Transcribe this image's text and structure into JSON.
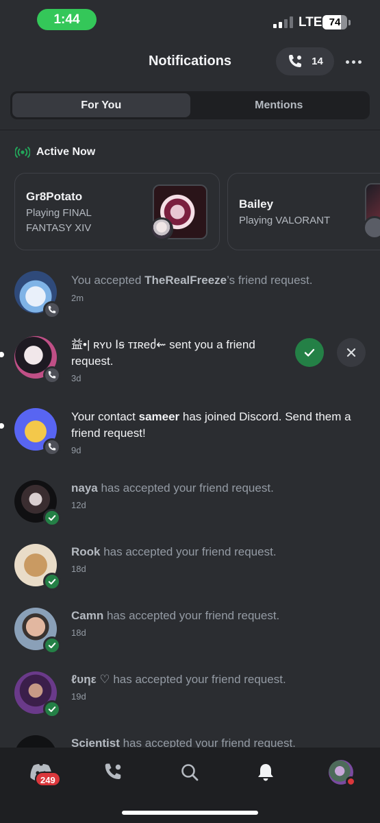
{
  "status": {
    "time": "1:44",
    "network": "LTE",
    "battery": "74",
    "battery_level": 0.74
  },
  "header": {
    "title": "Notifications",
    "call_count": "14",
    "more_icon": "more-horizontal-icon"
  },
  "tabs": [
    {
      "label": "For You",
      "active": true
    },
    {
      "label": "Mentions",
      "active": false
    }
  ],
  "active_now": {
    "title": "Active Now",
    "cards": [
      {
        "name": "Gr8Potato",
        "activity": "Playing FINAL FANTASY XIV"
      },
      {
        "name": "Bailey",
        "activity": "Playing VALORANT"
      }
    ]
  },
  "notifications": [
    {
      "user": "TheRealFreeze",
      "prefix": "You accepted ",
      "suffix": "’s friend request.",
      "time": "2m",
      "unread": false,
      "badge": "contact"
    },
    {
      "user": "益•| ʀʏᴜ Ⅰꞩ ᴛɪʀeძ⇜",
      "prefix": "",
      "suffix": " sent you a friend request.",
      "time": "3d",
      "unread": true,
      "badge": "contact"
    },
    {
      "user": "sameer",
      "prefix": "Your contact ",
      "suffix": " has joined Discord. Send them a friend request!",
      "time": "9d",
      "unread": true,
      "badge": "contact"
    },
    {
      "user": "naya",
      "prefix": "",
      "suffix": " has accepted your friend request.",
      "time": "12d",
      "unread": false,
      "badge": "check"
    },
    {
      "user": "Rook",
      "prefix": "",
      "suffix": " has accepted your friend request.",
      "time": "18d",
      "unread": false,
      "badge": "check"
    },
    {
      "user": "Camn",
      "prefix": "",
      "suffix": " has accepted your friend request.",
      "time": "18d",
      "unread": false,
      "badge": "check"
    },
    {
      "user": "ℓυηε ♡",
      "prefix": "",
      "suffix": " has accepted your friend request.",
      "time": "19d",
      "unread": false,
      "badge": "check"
    },
    {
      "user": "Scientist",
      "prefix": "",
      "suffix": " has accepted your friend request.",
      "time": "",
      "unread": false,
      "badge": ""
    }
  ],
  "nav": {
    "home_badge": "249"
  },
  "colors": {
    "background": "#2b2d31",
    "accent_green": "#248046",
    "badge_red": "#da373c",
    "status_green": "#34c759"
  }
}
